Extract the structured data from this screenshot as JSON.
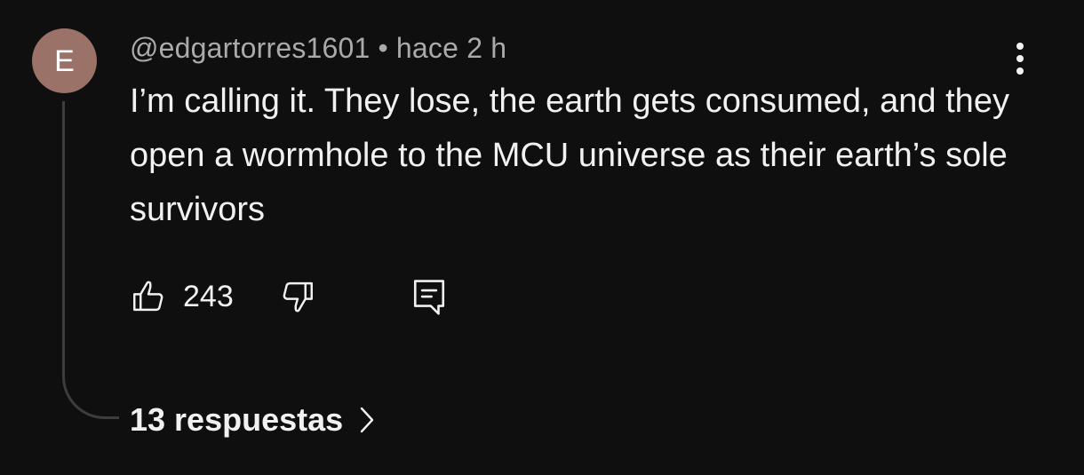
{
  "comment": {
    "avatar_letter": "E",
    "avatar_color": "#9a7268",
    "author": "@edgartorres1601",
    "separator": "•",
    "timestamp": "hace 2 h",
    "text": "I’m calling it. They lose, the earth gets consumed, and they open a wormhole to the MCU universe as their earth’s sole survivors",
    "more_icon": "vertical-ellipsis-icon"
  },
  "actions": {
    "like_icon": "thumbs-up-icon",
    "like_count": "243",
    "dislike_icon": "thumbs-down-icon",
    "reply_icon": "comment-reply-icon"
  },
  "replies": {
    "label": "13 respuestas",
    "icon": "chevron-right-icon"
  },
  "theme": {
    "background": "#0f0f0f",
    "primary_text": "#f1f1f1",
    "secondary_text": "#aaaaaa"
  }
}
